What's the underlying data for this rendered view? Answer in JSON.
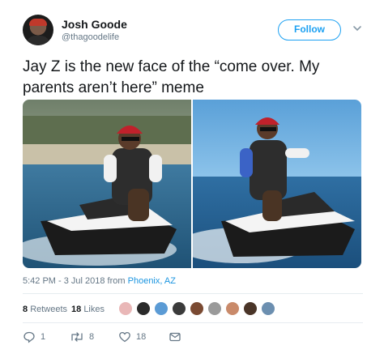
{
  "author": {
    "name": "Josh Goode",
    "handle": "@thagoodelife"
  },
  "follow_label": "Follow",
  "tweet_text": "Jay Z is the new face of the “come over. My parents aren’t here” meme",
  "timestamp": {
    "time_date": "5:42 PM - 3 Jul 2018 from ",
    "location": "Phoenix, AZ"
  },
  "stats": {
    "retweets_count": "8",
    "retweets_label": "Retweets",
    "likes_count": "18",
    "likes_label": "Likes"
  },
  "actions": {
    "reply_count": "1",
    "retweet_count": "8",
    "like_count": "18"
  },
  "icons": [
    "chevron-down-icon",
    "reply-icon",
    "retweet-icon",
    "heart-icon",
    "message-icon"
  ],
  "colors": {
    "accent": "#1da1f2",
    "muted": "#657786",
    "text": "#14171a"
  }
}
